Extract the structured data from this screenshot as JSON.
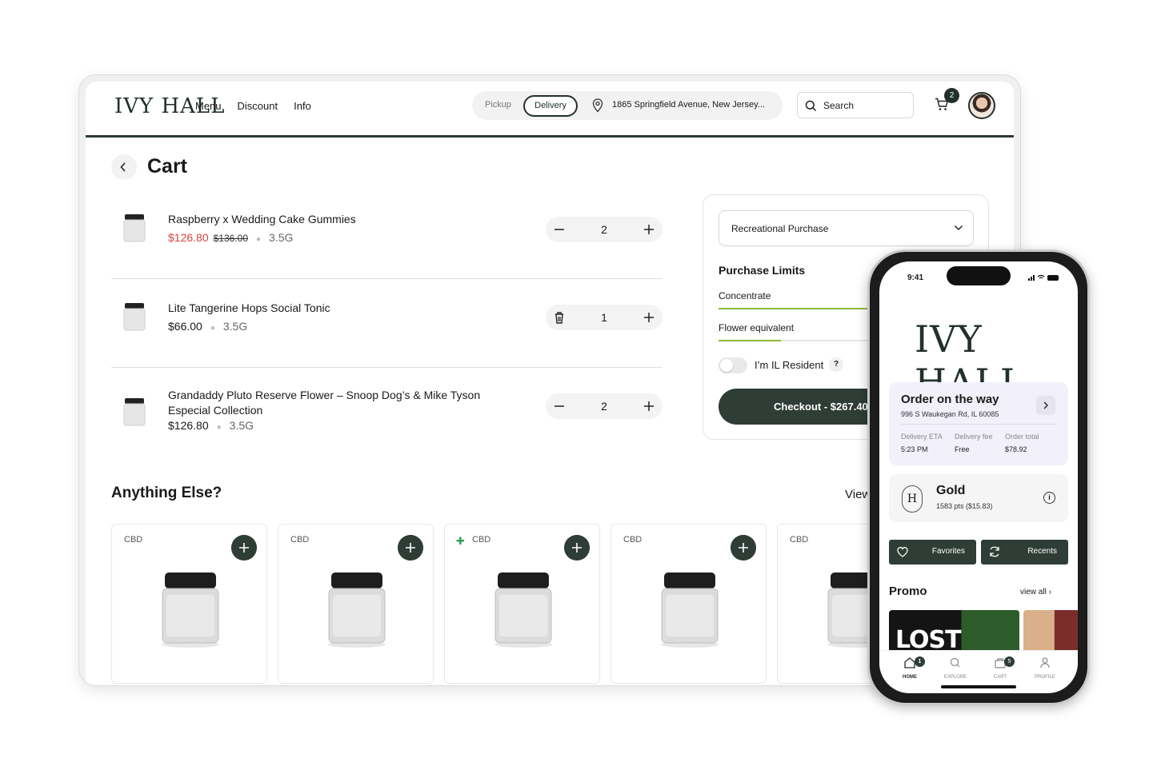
{
  "header": {
    "logo": "IVY HALL",
    "nav": [
      "Menu",
      "Discount",
      "Info"
    ],
    "mode_pickup": "Pickup",
    "mode_delivery": "Delivery",
    "address": "1865 Springfield Avenue, New Jersey...",
    "search_placeholder": "Search",
    "cart_count": "2"
  },
  "cart": {
    "title": "Cart",
    "items": [
      {
        "name": "Raspberry x Wedding Cake Gummies",
        "price": "$126.80",
        "original_price": "$136.00",
        "weight": "3.5G",
        "qty": "2",
        "on_sale": true
      },
      {
        "name": "Lite Tangerine Hops Social Tonic",
        "price": "$66.00",
        "weight": "3.5G",
        "qty": "1"
      },
      {
        "name": "Grandaddy Pluto Reserve Flower – Snoop Dog’s & Mike Tyson Especial Collection",
        "price": "$126.80",
        "weight": "3.5G",
        "qty": "2"
      }
    ]
  },
  "summary": {
    "purchase_type": "Recreational Purchase",
    "limits_title": "Purchase Limits",
    "limits": [
      {
        "label": "Concentrate",
        "fill": 0.62
      },
      {
        "label": "Flower equivalent",
        "fill": 0.26
      }
    ],
    "resident_label": "I’m IL Resident",
    "help": "?",
    "checkout": "Checkout - $267.40"
  },
  "suggestions": {
    "title": "Anything Else?",
    "view_all": "View all",
    "tags": [
      "CBD",
      "CBD",
      "CBD",
      "CBD",
      "CBD"
    ]
  },
  "phone": {
    "time": "9:41",
    "logo": "IVY HALL",
    "order_title": "Order on the way",
    "order_address": "996 S Waukegan Rd, IL 60085",
    "eta_label": "Delivery ETA",
    "eta_value": "5:23 PM",
    "fee_label": "Delivery fee",
    "fee_value": "Free",
    "total_label": "Order total",
    "total_value": "$78.92",
    "tier": "Gold",
    "points": "1583 pts ($15.83)",
    "favorites": "Favorites",
    "recents": "Recents",
    "promo": "Promo",
    "view_all": "view all",
    "promo_text": "LOST",
    "tabs": [
      "HOME",
      "EXPLORE",
      "CART",
      "PROFILE"
    ],
    "home_badge": "1",
    "cart_badge": "5"
  },
  "colors": {
    "brand_dark": "#2e3d36",
    "sale": "#d64541",
    "limit_bar": "#8bb83a"
  }
}
